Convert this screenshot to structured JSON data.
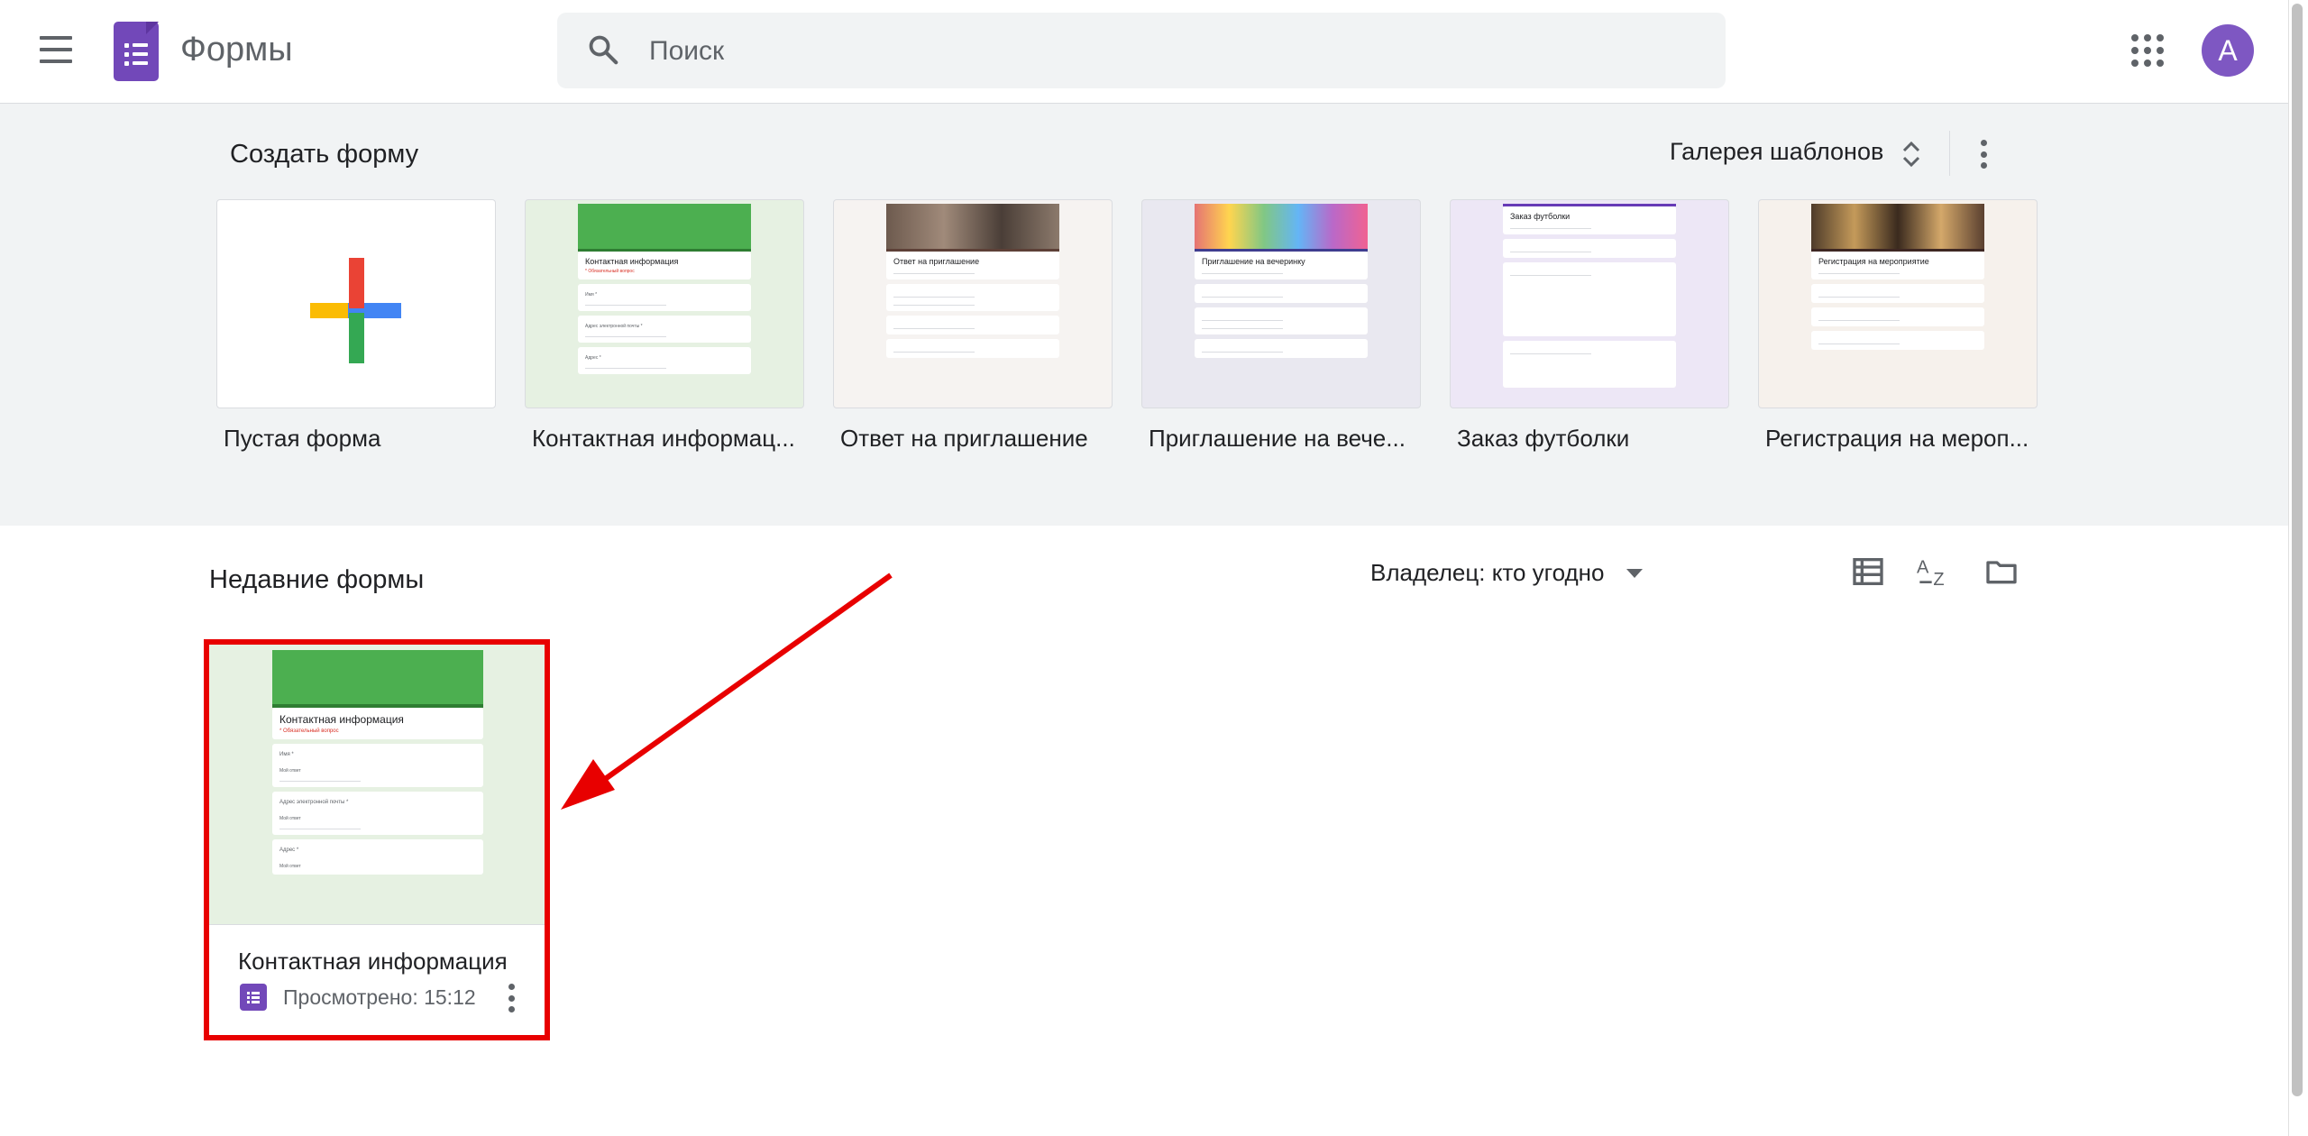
{
  "app": {
    "name": "Формы",
    "search_placeholder": "Поиск",
    "avatar_letter": "А"
  },
  "gallery": {
    "title": "Создать форму",
    "gallery_button": "Галерея шаблонов",
    "templates": [
      {
        "label": "Пустая форма"
      },
      {
        "label": "Контактная информац...",
        "heading": "Контактная информация",
        "required_note": "* Обязательный вопрос",
        "fields": [
          "Имя *",
          "Адрес электронной почты *",
          "Адрес *"
        ]
      },
      {
        "label": "Ответ на приглашение",
        "heading": "Ответ на приглашение"
      },
      {
        "label": "Приглашение на вече...",
        "heading": "Приглашение на вечеринку"
      },
      {
        "label": "Заказ футболки",
        "heading": "Заказ футболки"
      },
      {
        "label": "Регистрация на мероп...",
        "heading": "Регистрация на мероприятие"
      }
    ]
  },
  "recent": {
    "title": "Недавние формы",
    "owner_filter": "Владелец: кто угодно",
    "docs": [
      {
        "name": "Контактная информация",
        "meta": "Просмотрено: 15:12",
        "preview_heading": "Контактная информация",
        "preview_required": "* Обязательный вопрос",
        "preview_fields": [
          "Имя *",
          "Адрес электронной почты *",
          "Адрес *"
        ],
        "preview_answer": "Мой ответ"
      }
    ]
  },
  "colors": {
    "brand": "#7248b9",
    "highlight": "#e80000",
    "gallery_bg": "#f1f3f4"
  }
}
